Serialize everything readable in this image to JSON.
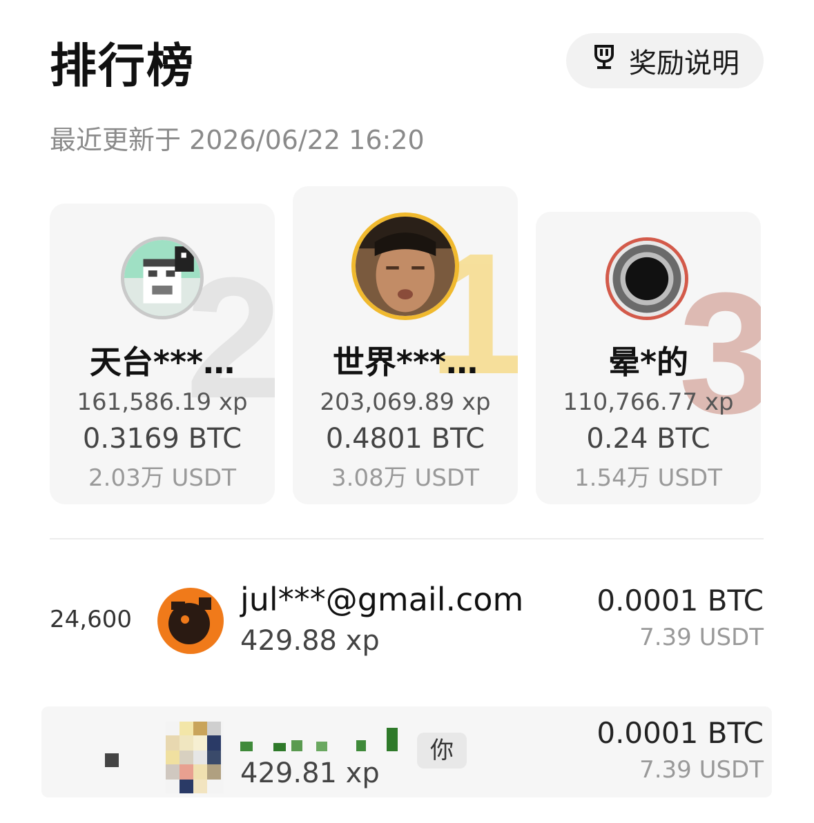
{
  "header": {
    "title": "排行榜",
    "rewards_label": "奖励说明"
  },
  "updated_text": "最近更新于 2026/06/22 16:20",
  "podium": [
    {
      "rank": "2",
      "name": "天台***…",
      "xp": "161,586.19 xp",
      "btc": "0.3169 BTC",
      "usdt": "2.03万 USDT"
    },
    {
      "rank": "1",
      "name": "世界***…",
      "xp": "203,069.89 xp",
      "btc": "0.4801 BTC",
      "usdt": "3.08万 USDT"
    },
    {
      "rank": "3",
      "name": "晕*的",
      "xp": "110,766.77 xp",
      "btc": "0.24 BTC",
      "usdt": "1.54万 USDT"
    }
  ],
  "rows": [
    {
      "rank": "24,600",
      "name": "jul***@gmail.com",
      "xp": "429.88 xp",
      "btc": "0.0001 BTC",
      "usdt": "7.39 USDT"
    }
  ],
  "me": {
    "xp": "429.81 xp",
    "badge": "你",
    "btc": "0.0001 BTC",
    "usdt": "7.39 USDT"
  },
  "colors": {
    "gold": "#f0b92e",
    "silver": "#c9c9c9",
    "bronze": "#d35a4a"
  }
}
